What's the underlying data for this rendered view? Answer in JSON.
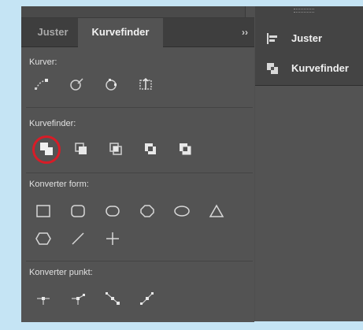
{
  "panel": {
    "tabs": [
      {
        "label": "Juster",
        "active": false
      },
      {
        "label": "Kurvefinder",
        "active": true
      }
    ],
    "collapse_glyph": "››"
  },
  "sections": {
    "kurver": {
      "label": "Kurver:",
      "tools": [
        "smooth-curve-icon",
        "erase-curve-icon",
        "close-curve-icon",
        "reverse-curve-icon"
      ]
    },
    "kurvefinder": {
      "label": "Kurvefinder:",
      "tools": [
        "merge-icon",
        "intersect-icon",
        "exclude-icon",
        "combine-icon",
        "minus-front-icon"
      ]
    },
    "konverter_form": {
      "label": "Konverter form:",
      "tools": [
        "rectangle-icon",
        "rounded-rectangle-icon",
        "beveled-rectangle-icon",
        "octagon-icon",
        "ellipse-icon",
        "triangle-icon",
        "hexagon-icon",
        "line-icon",
        "plus-icon"
      ]
    },
    "konverter_punkt": {
      "label": "Konverter punkt:",
      "tools": [
        "plain-point-icon",
        "corner-point-icon",
        "smooth-point-icon",
        "symmetrical-point-icon"
      ]
    }
  },
  "right_panel": {
    "items": [
      {
        "label": "Juster",
        "icon": "align-icon"
      },
      {
        "label": "Kurvefinder",
        "icon": "pathfinder-icon"
      }
    ]
  },
  "colors": {
    "highlight": "#d81c27",
    "panel_bg": "#535353",
    "tabbar_bg": "#3e3e3e"
  }
}
